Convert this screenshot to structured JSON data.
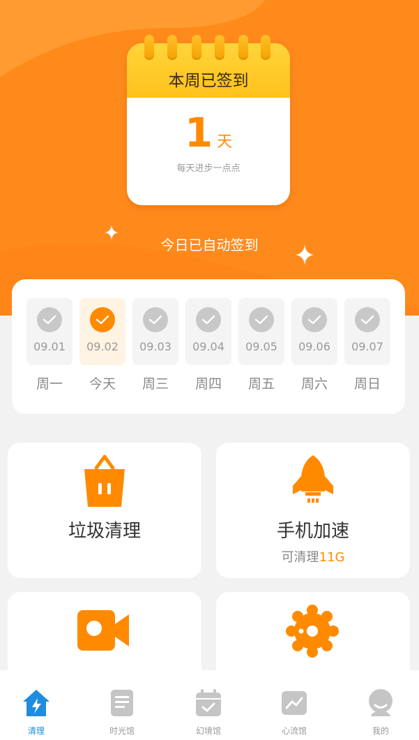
{
  "calendar": {
    "title": "本周已签到",
    "count": "1",
    "unit": "天",
    "subtitle": "每天进步一点点"
  },
  "auto_sign_text": "今日已自动签到",
  "week": {
    "days": [
      {
        "date": "09.01",
        "label": "周一",
        "today": false
      },
      {
        "date": "09.02",
        "label": "今天",
        "today": true
      },
      {
        "date": "09.03",
        "label": "周三",
        "today": false
      },
      {
        "date": "09.04",
        "label": "周四",
        "today": false
      },
      {
        "date": "09.05",
        "label": "周五",
        "today": false
      },
      {
        "date": "09.06",
        "label": "周六",
        "today": false
      },
      {
        "date": "09.07",
        "label": "周日",
        "today": false
      }
    ]
  },
  "tiles": {
    "trash": {
      "title": "垃圾清理",
      "icon": "trash-basket-icon"
    },
    "speed": {
      "title": "手机加速",
      "sub_prefix": "可清理",
      "sub_value": "11G",
      "icon": "rocket-icon"
    },
    "video": {
      "icon": "video-camera-icon"
    },
    "settings": {
      "icon": "gear-icon"
    }
  },
  "tabbar": {
    "tabs": [
      {
        "label": "清理",
        "icon": "home-bolt-icon",
        "active": true
      },
      {
        "label": "时光馆",
        "icon": "document-icon",
        "active": false
      },
      {
        "label": "幻境馆",
        "icon": "calendar-check-icon",
        "active": false
      },
      {
        "label": "心流馆",
        "icon": "chart-icon",
        "active": false
      },
      {
        "label": "我的",
        "icon": "profile-icon",
        "active": false
      }
    ]
  },
  "colors": {
    "accent": "#ff8a00",
    "hero": "#ff8a1c",
    "active_tab": "#1e8de0"
  }
}
